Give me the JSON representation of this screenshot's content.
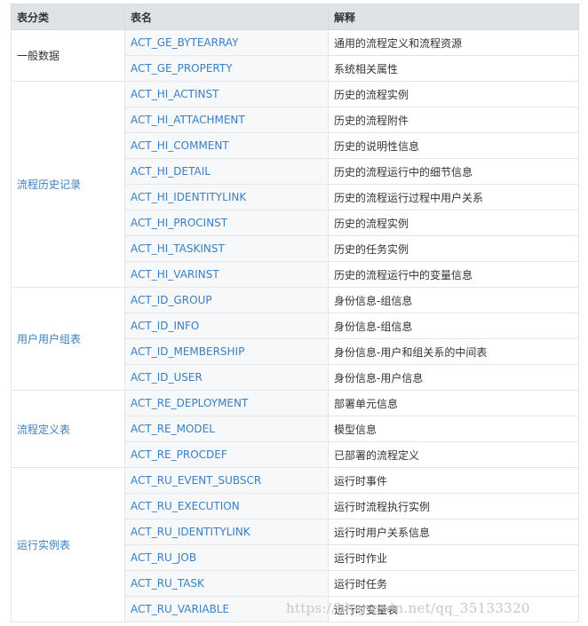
{
  "header": {
    "category": "表分类",
    "name": "表名",
    "description": "解释"
  },
  "groups": [
    {
      "category": "一般数据",
      "rows": [
        {
          "name": "ACT_GE_BYTEARRAY",
          "desc": "通用的流程定义和流程资源"
        },
        {
          "name": "ACT_GE_PROPERTY",
          "desc": "系统相关属性"
        }
      ]
    },
    {
      "category": "流程历史记录",
      "rows": [
        {
          "name": "ACT_HI_ACTINST",
          "desc": "历史的流程实例"
        },
        {
          "name": "ACT_HI_ATTACHMENT",
          "desc": "历史的流程附件"
        },
        {
          "name": "ACT_HI_COMMENT",
          "desc": "历史的说明性信息"
        },
        {
          "name": "ACT_HI_DETAIL",
          "desc": "历史的流程运行中的细节信息"
        },
        {
          "name": "ACT_HI_IDENTITYLINK",
          "desc": "历史的流程运行过程中用户关系"
        },
        {
          "name": "ACT_HI_PROCINST",
          "desc": "历史的流程实例"
        },
        {
          "name": "ACT_HI_TASKINST",
          "desc": "历史的任务实例"
        },
        {
          "name": "ACT_HI_VARINST",
          "desc": "历史的流程运行中的变量信息"
        }
      ]
    },
    {
      "category": "用户用户组表",
      "rows": [
        {
          "name": "ACT_ID_GROUP",
          "desc": "身份信息-组信息"
        },
        {
          "name": "ACT_ID_INFO",
          "desc": "身份信息-组信息"
        },
        {
          "name": "ACT_ID_MEMBERSHIP",
          "desc": "身份信息-用户和组关系的中间表"
        },
        {
          "name": "ACT_ID_USER",
          "desc": "身份信息-用户信息"
        }
      ]
    },
    {
      "category": "流程定义表",
      "rows": [
        {
          "name": "ACT_RE_DEPLOYMENT",
          "desc": "部署单元信息"
        },
        {
          "name": "ACT_RE_MODEL",
          "desc": "模型信息"
        },
        {
          "name": "ACT_RE_PROCDEF",
          "desc": "已部署的流程定义"
        }
      ]
    },
    {
      "category": "运行实例表",
      "rows": [
        {
          "name": "ACT_RU_EVENT_SUBSCR",
          "desc": "运行时事件"
        },
        {
          "name": "ACT_RU_EXECUTION",
          "desc": "运行时流程执行实例"
        },
        {
          "name": "ACT_RU_IDENTITYLINK",
          "desc": "运行时用户关系信息"
        },
        {
          "name": "ACT_RU_JOB",
          "desc": "运行时作业"
        },
        {
          "name": "ACT_RU_TASK",
          "desc": "运行时任务"
        },
        {
          "name": "ACT_RU_VARIABLE",
          "desc": "运行时变量表"
        }
      ]
    }
  ],
  "watermark": "https://blog.csdn.net/qq_35133320"
}
